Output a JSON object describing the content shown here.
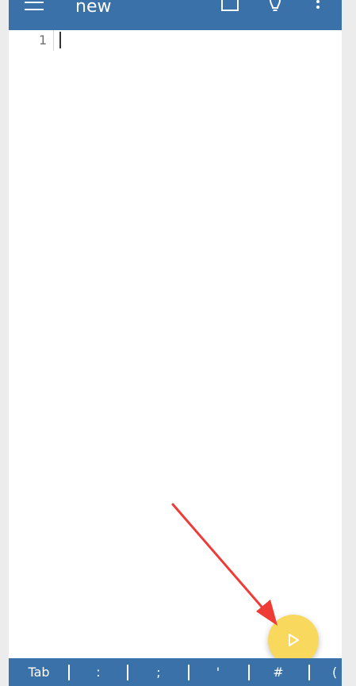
{
  "appbar": {
    "title": "new",
    "menu_icon": "hamburger-menu-icon",
    "window_icon": "window-icon",
    "tip_icon": "lightbulb-icon",
    "more_icon": "more-vert-icon",
    "color": "#3a71a8"
  },
  "editor": {
    "line_numbers": [
      "1"
    ],
    "content": ""
  },
  "fab": {
    "icon": "play-icon",
    "color": "#f9d85e"
  },
  "annotation": {
    "arrow_color": "#ee3b35"
  },
  "keybar": {
    "keys": [
      "Tab",
      ":",
      ";",
      "'",
      "#",
      "("
    ]
  }
}
